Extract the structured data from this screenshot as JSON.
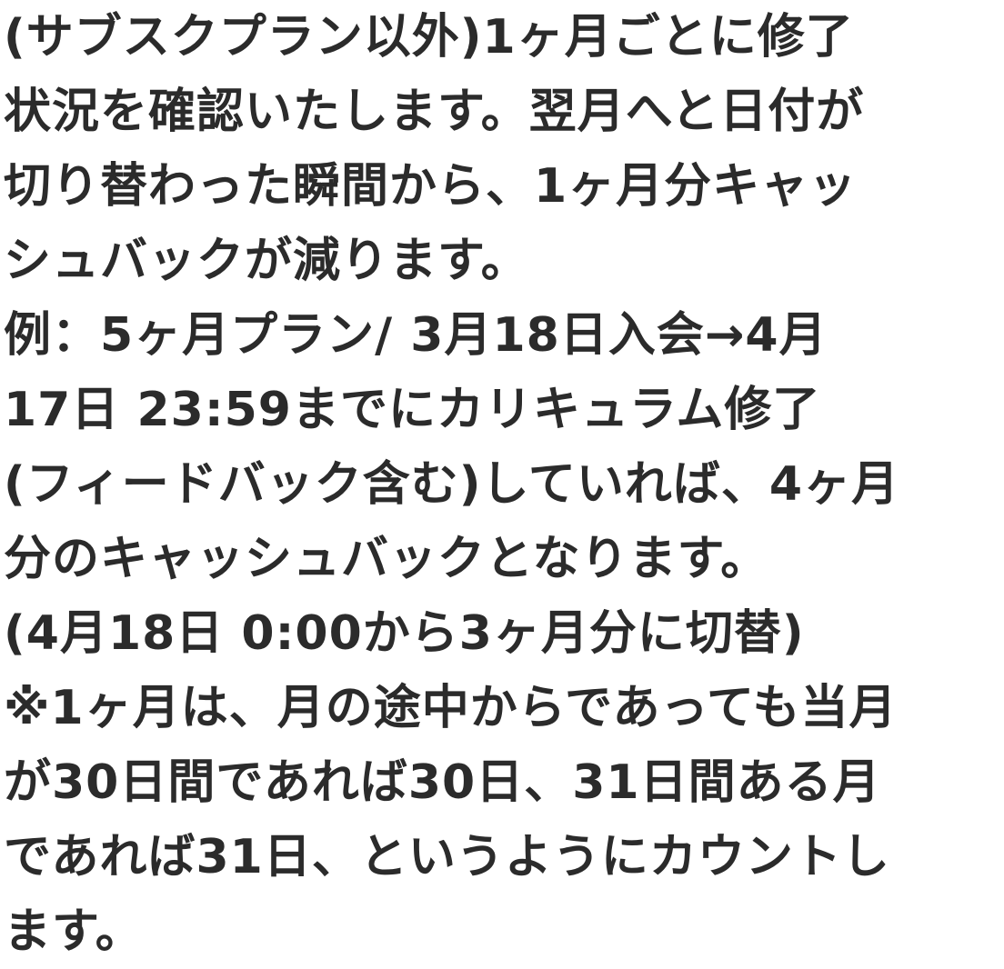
{
  "document": {
    "lines": [
      "(サブスクプラン以外)1ヶ月ごとに修了",
      "状況を確認いたします。翌月へと日付が",
      "切り替わった瞬間から、1ヶ月分キャッ",
      "シュバックが減ります。",
      "例：5ヶ月プラン/ 3月18日入会→4月",
      "17日 23:59までにカリキュラム修了",
      "(フィードバック含む)していれば、4ヶ月",
      "分のキャッシュバックとなります。",
      "(4月18日 0:00から3ヶ月分に切替)",
      "※1ヶ月は、月の途中からであっても当月",
      "が30日間であれば30日、31日間ある月",
      "であれば31日、というようにカウントし",
      "ます。"
    ]
  }
}
